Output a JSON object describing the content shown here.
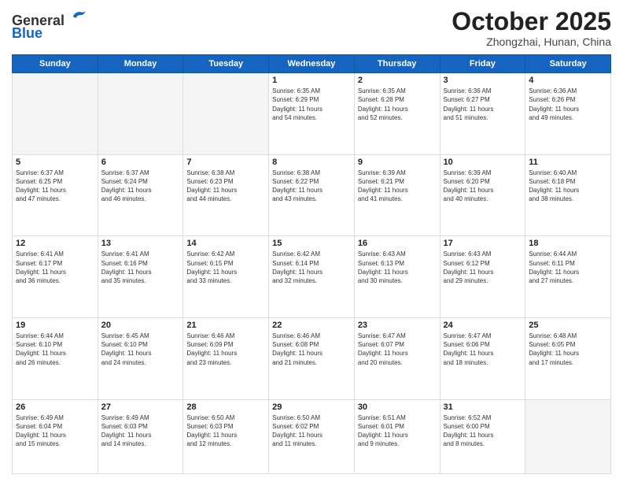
{
  "header": {
    "logo_line1": "General",
    "logo_line2": "Blue",
    "month": "October 2025",
    "location": "Zhongzhai, Hunan, China"
  },
  "days_of_week": [
    "Sunday",
    "Monday",
    "Tuesday",
    "Wednesday",
    "Thursday",
    "Friday",
    "Saturday"
  ],
  "weeks": [
    [
      {
        "day": "",
        "info": ""
      },
      {
        "day": "",
        "info": ""
      },
      {
        "day": "",
        "info": ""
      },
      {
        "day": "1",
        "info": "Sunrise: 6:35 AM\nSunset: 6:29 PM\nDaylight: 11 hours\nand 54 minutes."
      },
      {
        "day": "2",
        "info": "Sunrise: 6:35 AM\nSunset: 6:28 PM\nDaylight: 11 hours\nand 52 minutes."
      },
      {
        "day": "3",
        "info": "Sunrise: 6:36 AM\nSunset: 6:27 PM\nDaylight: 11 hours\nand 51 minutes."
      },
      {
        "day": "4",
        "info": "Sunrise: 6:36 AM\nSunset: 6:26 PM\nDaylight: 11 hours\nand 49 minutes."
      }
    ],
    [
      {
        "day": "5",
        "info": "Sunrise: 6:37 AM\nSunset: 6:25 PM\nDaylight: 11 hours\nand 47 minutes."
      },
      {
        "day": "6",
        "info": "Sunrise: 6:37 AM\nSunset: 6:24 PM\nDaylight: 11 hours\nand 46 minutes."
      },
      {
        "day": "7",
        "info": "Sunrise: 6:38 AM\nSunset: 6:23 PM\nDaylight: 11 hours\nand 44 minutes."
      },
      {
        "day": "8",
        "info": "Sunrise: 6:38 AM\nSunset: 6:22 PM\nDaylight: 11 hours\nand 43 minutes."
      },
      {
        "day": "9",
        "info": "Sunrise: 6:39 AM\nSunset: 6:21 PM\nDaylight: 11 hours\nand 41 minutes."
      },
      {
        "day": "10",
        "info": "Sunrise: 6:39 AM\nSunset: 6:20 PM\nDaylight: 11 hours\nand 40 minutes."
      },
      {
        "day": "11",
        "info": "Sunrise: 6:40 AM\nSunset: 6:18 PM\nDaylight: 11 hours\nand 38 minutes."
      }
    ],
    [
      {
        "day": "12",
        "info": "Sunrise: 6:41 AM\nSunset: 6:17 PM\nDaylight: 11 hours\nand 36 minutes."
      },
      {
        "day": "13",
        "info": "Sunrise: 6:41 AM\nSunset: 6:16 PM\nDaylight: 11 hours\nand 35 minutes."
      },
      {
        "day": "14",
        "info": "Sunrise: 6:42 AM\nSunset: 6:15 PM\nDaylight: 11 hours\nand 33 minutes."
      },
      {
        "day": "15",
        "info": "Sunrise: 6:42 AM\nSunset: 6:14 PM\nDaylight: 11 hours\nand 32 minutes."
      },
      {
        "day": "16",
        "info": "Sunrise: 6:43 AM\nSunset: 6:13 PM\nDaylight: 11 hours\nand 30 minutes."
      },
      {
        "day": "17",
        "info": "Sunrise: 6:43 AM\nSunset: 6:12 PM\nDaylight: 11 hours\nand 29 minutes."
      },
      {
        "day": "18",
        "info": "Sunrise: 6:44 AM\nSunset: 6:11 PM\nDaylight: 11 hours\nand 27 minutes."
      }
    ],
    [
      {
        "day": "19",
        "info": "Sunrise: 6:44 AM\nSunset: 6:10 PM\nDaylight: 11 hours\nand 26 minutes."
      },
      {
        "day": "20",
        "info": "Sunrise: 6:45 AM\nSunset: 6:10 PM\nDaylight: 11 hours\nand 24 minutes."
      },
      {
        "day": "21",
        "info": "Sunrise: 6:46 AM\nSunset: 6:09 PM\nDaylight: 11 hours\nand 23 minutes."
      },
      {
        "day": "22",
        "info": "Sunrise: 6:46 AM\nSunset: 6:08 PM\nDaylight: 11 hours\nand 21 minutes."
      },
      {
        "day": "23",
        "info": "Sunrise: 6:47 AM\nSunset: 6:07 PM\nDaylight: 11 hours\nand 20 minutes."
      },
      {
        "day": "24",
        "info": "Sunrise: 6:47 AM\nSunset: 6:06 PM\nDaylight: 11 hours\nand 18 minutes."
      },
      {
        "day": "25",
        "info": "Sunrise: 6:48 AM\nSunset: 6:05 PM\nDaylight: 11 hours\nand 17 minutes."
      }
    ],
    [
      {
        "day": "26",
        "info": "Sunrise: 6:49 AM\nSunset: 6:04 PM\nDaylight: 11 hours\nand 15 minutes."
      },
      {
        "day": "27",
        "info": "Sunrise: 6:49 AM\nSunset: 6:03 PM\nDaylight: 11 hours\nand 14 minutes."
      },
      {
        "day": "28",
        "info": "Sunrise: 6:50 AM\nSunset: 6:03 PM\nDaylight: 11 hours\nand 12 minutes."
      },
      {
        "day": "29",
        "info": "Sunrise: 6:50 AM\nSunset: 6:02 PM\nDaylight: 11 hours\nand 11 minutes."
      },
      {
        "day": "30",
        "info": "Sunrise: 6:51 AM\nSunset: 6:01 PM\nDaylight: 11 hours\nand 9 minutes."
      },
      {
        "day": "31",
        "info": "Sunrise: 6:52 AM\nSunset: 6:00 PM\nDaylight: 11 hours\nand 8 minutes."
      },
      {
        "day": "",
        "info": ""
      }
    ]
  ]
}
